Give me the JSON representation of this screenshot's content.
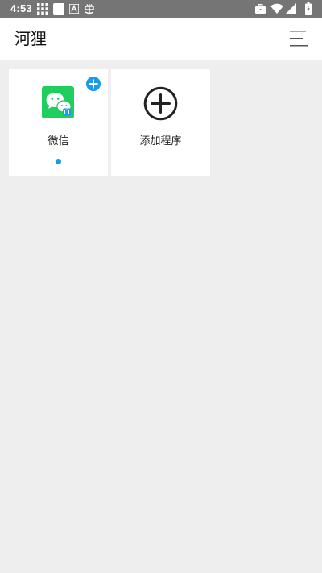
{
  "status_bar": {
    "time": "4:53",
    "left_icons": [
      "grid-icon",
      "notification-square-icon",
      "font-icon",
      "bug-icon"
    ],
    "right_icons": [
      "briefcase-icon",
      "wifi-icon",
      "signal-icon",
      "battery-icon"
    ]
  },
  "header": {
    "title": "河狸",
    "menu_icon": "menu-lines-icon"
  },
  "tiles": [
    {
      "label": "微信",
      "icon": "wechat-icon",
      "badge_icon": "plus-circle-badge-icon",
      "running_indicator": true
    },
    {
      "label": "添加程序",
      "icon": "add-circle-icon"
    }
  ],
  "colors": {
    "status_bar": "#757575",
    "background": "#eeeeee",
    "tile": "#ffffff",
    "wechat_green": "#1ece5e",
    "accent_blue": "#1a9be8"
  }
}
